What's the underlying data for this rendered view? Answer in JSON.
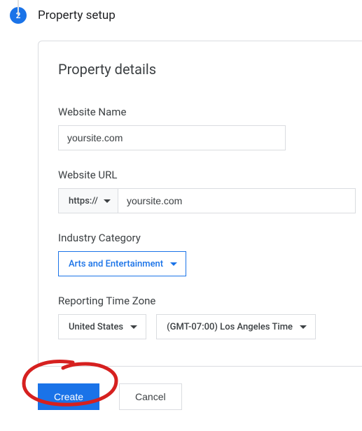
{
  "step": {
    "number": "2",
    "title": "Property setup"
  },
  "card": {
    "title": "Property details"
  },
  "fields": {
    "website_name": {
      "label": "Website Name",
      "value": "yoursite.com"
    },
    "website_url": {
      "label": "Website URL",
      "scheme": "https://",
      "value": "yoursite.com"
    },
    "industry": {
      "label": "Industry Category",
      "value": "Arts and Entertainment"
    },
    "timezone": {
      "label": "Reporting Time Zone",
      "country": "United States",
      "tz": "(GMT-07:00) Los Angeles Time"
    }
  },
  "actions": {
    "create": "Create",
    "cancel": "Cancel"
  }
}
